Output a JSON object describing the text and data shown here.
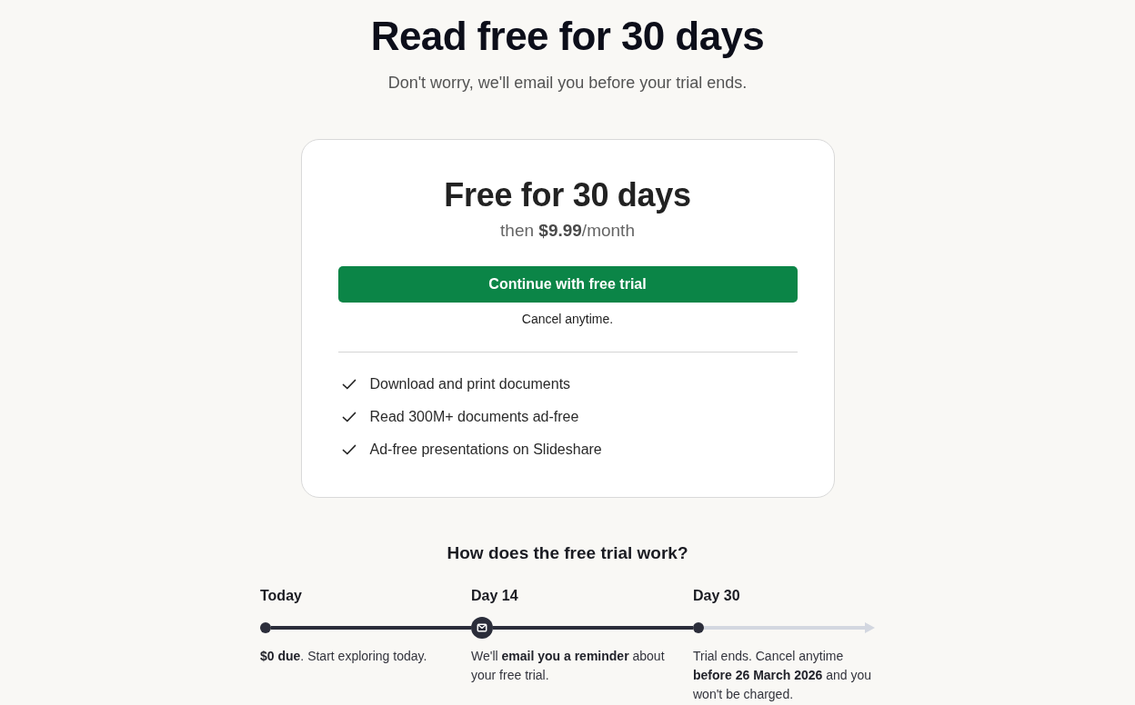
{
  "header": {
    "title": "Read free for 30 days",
    "subtitle": "Don't worry, we'll email you before your trial ends."
  },
  "plan_card": {
    "title": "Free for 30 days",
    "price": "then **$9.99**/month",
    "button": "Continue with free trial",
    "note": "Cancel anytime.",
    "features": [
      "Download and print documents",
      "Read 300M+ documents ad-free",
      "Ad-free presentations on Slideshare"
    ]
  },
  "timeline": {
    "heading": "How does the free trial work?",
    "steps": [
      {
        "label": "Today",
        "kind": "dot",
        "description": "**$0 due**. Start exploring today."
      },
      {
        "label": "Day 14",
        "kind": "envelope",
        "description": "We'll **email you a reminder** about your free trial."
      },
      {
        "label": "Day 30",
        "kind": "dot",
        "description": "Trial ends. Cancel anytime **before 26 March 2026** and you won't be charged."
      }
    ]
  }
}
